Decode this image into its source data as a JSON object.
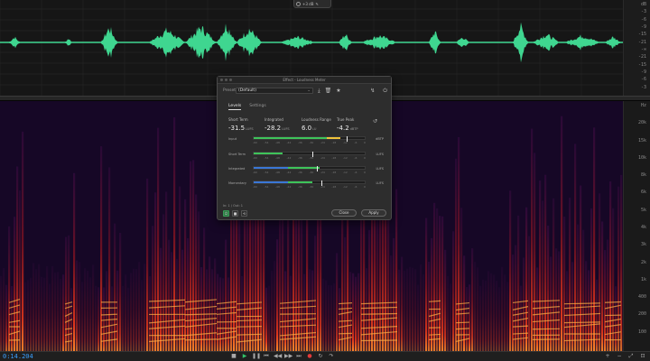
{
  "hud": {
    "zoom": "+3 dB"
  },
  "wave_ruler": [
    "dB",
    "-3",
    "-6",
    "-9",
    "-15",
    "-21",
    "-∞",
    "-21",
    "-15",
    "-9",
    "-6",
    "-3"
  ],
  "spec_ruler": [
    "Hz",
    "20k",
    "15k",
    "10k",
    "8k",
    "6k",
    "5k",
    "4k",
    "3k",
    "2k",
    "1k",
    "400",
    "200",
    "100"
  ],
  "dialog": {
    "title": "Effect - Loudness Meter",
    "presets_label": "Presets:",
    "preset_value": "(Default)",
    "tabs": [
      {
        "label": "Levels",
        "active": true
      },
      {
        "label": "Settings",
        "active": false
      }
    ],
    "stats": [
      {
        "label": "Short Term",
        "value": "-31.5",
        "unit": "LUFS"
      },
      {
        "label": "Integrated",
        "value": "-28.2",
        "unit": "LUFS"
      },
      {
        "label": "Loudness Range",
        "value": "6.0",
        "unit": "LU"
      },
      {
        "label": "True Peak",
        "value": "-4.2",
        "unit": "dBTP"
      }
    ],
    "meters": [
      {
        "label": "Input",
        "unit": "dBTP",
        "green": 0.66,
        "blue": 0.0,
        "yellow": 0.12,
        "marker": 0.84
      },
      {
        "label": "Short Term",
        "unit": "LUFS",
        "green": 0.26,
        "blue": 0.0,
        "marker": 0.53
      },
      {
        "label": "Integrated",
        "unit": "LUFS",
        "green": 0.28,
        "blue": 0.31,
        "marker": 0.57
      },
      {
        "label": "Momentary",
        "unit": "LUFS",
        "green": 0.22,
        "blue": 0.31,
        "marker": 0.61
      }
    ],
    "ticks": [
      "-60",
      "-54",
      "-48",
      "-42",
      "-36",
      "-30",
      "-24",
      "-18",
      "-12",
      "-6",
      "0"
    ],
    "io": "In: 1 / Out: 1",
    "close": "Close",
    "apply": "Apply"
  },
  "transport": {
    "time": "0:14.204"
  },
  "colors": {
    "wave": "#3fd690",
    "time": "#3aa0ff",
    "meter_green": "#3ec45a",
    "meter_blue": "#3a77d6",
    "meter_yellow": "#f0c33a"
  }
}
